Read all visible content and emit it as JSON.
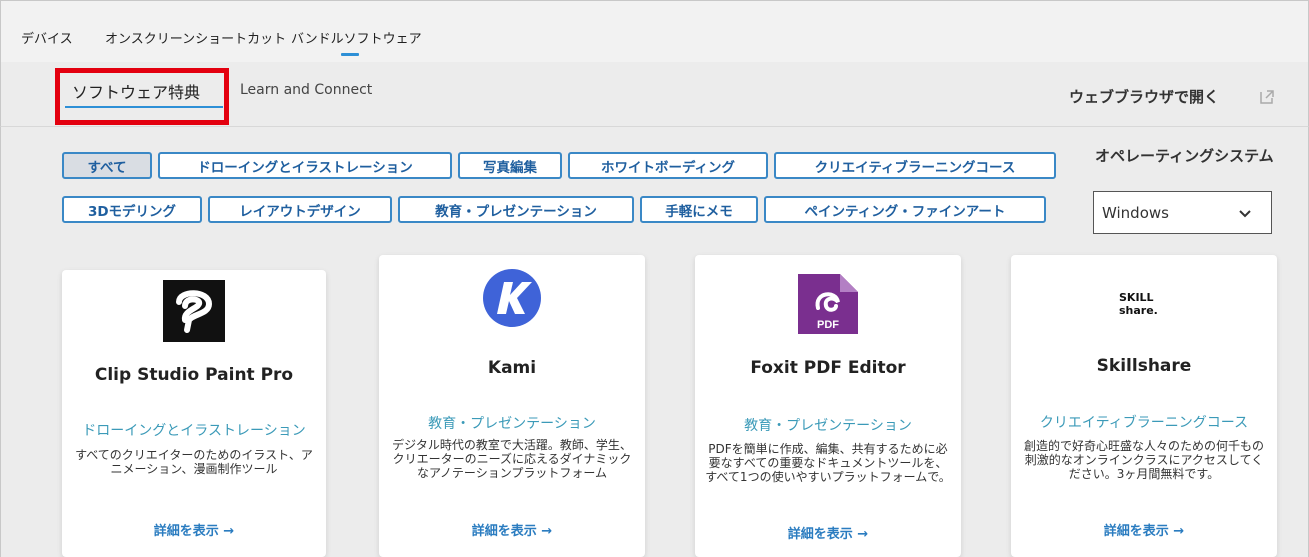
{
  "top_nav": {
    "tabs": [
      "デバイス",
      "オンスクリーンショートカット",
      "バンドルソフトウェア"
    ],
    "active_index": 2
  },
  "sub_nav": {
    "tabs": [
      "ソフトウェア特典",
      "Learn and Connect"
    ],
    "active_index": 0,
    "open_in_browser": "ウェブブラウザで開く",
    "open_icon": "external-link-icon"
  },
  "filters": {
    "row1": [
      "すべて",
      "ドローイングとイラストレーション",
      "写真編集",
      "ホワイトボーディング",
      "クリエイティブラーニングコース"
    ],
    "row2": [
      "3Dモデリング",
      "レイアウトデザイン",
      "教育・プレゼンテーション",
      "手軽にメモ",
      "ペインティング・ファインアート"
    ],
    "selected": "すべて"
  },
  "os": {
    "label": "オペレーティングシステム",
    "selected": "Windows"
  },
  "cards": [
    {
      "title": "Clip Studio Paint Pro",
      "category": "ドローイングとイラストレーション",
      "description": "すべてのクリエイターのためのイラスト、アニメーション、漫画制作ツール",
      "link": "詳細を表示 →",
      "logo": "clip-studio-logo"
    },
    {
      "title": "Kami",
      "category": "教育・プレゼンテーション",
      "description": "デジタル時代の教室で大活躍。教師、学生、クリエーターのニーズに応えるダイナミックなアノテーションプラットフォーム",
      "link": "詳細を表示 →",
      "logo": "kami-logo"
    },
    {
      "title": "Foxit PDF Editor",
      "category": "教育・プレゼンテーション",
      "description": "PDFを簡単に作成、編集、共有するために必要なすべての重要なドキュメントツールを、すべて1つの使いやすいプラットフォームで。",
      "link": "詳細を表示 →",
      "logo": "foxit-pdf-logo",
      "logo_text": "PDF"
    },
    {
      "title": "Skillshare",
      "category": "クリエイティブラーニングコース",
      "description": "創造的で好奇心旺盛な人々のための何千もの刺激的なオンラインクラスにアクセスしてください。3ヶ月間無料です。",
      "link": "詳細を表示 →",
      "logo": "skillshare-logo",
      "logo_text": [
        "SKILL",
        "share."
      ]
    }
  ],
  "colors": {
    "accent": "#2d8fd6",
    "highlight_box": "#e3000f",
    "chip_text": "#1f5f9f",
    "category_text": "#3b9ab8",
    "kami_blue": "#3f63d8",
    "foxit_purple": "#7a2f8f"
  }
}
